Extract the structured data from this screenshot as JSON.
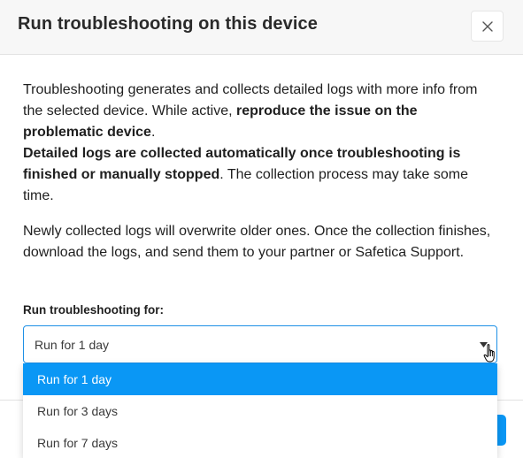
{
  "dialog": {
    "title": "Run troubleshooting on this device",
    "close_icon": "close-icon"
  },
  "body": {
    "paragraph1": {
      "t1": "Troubleshooting generates and collects detailed logs with more info from the selected device. While active, ",
      "b1": "reproduce the issue on the problematic device",
      "t2": ".",
      "b2": "Detailed logs are collected automatically once troubleshooting is finished or manually stopped",
      "t3": ". The collection process may take some time."
    },
    "paragraph2": "Newly collected logs will overwrite older ones. Once the collection finishes, download the logs, and send them to your partner or Safetica Support."
  },
  "duration": {
    "label": "Run troubleshooting for:",
    "selected": "Run for 1 day",
    "arrow_icon": "caret-down-icon",
    "options": [
      {
        "label": "Run for 1 day",
        "selected": true
      },
      {
        "label": "Run for 3 days",
        "selected": false
      },
      {
        "label": "Run for 7 days",
        "selected": false
      }
    ]
  },
  "colors": {
    "accent": "#0a97f5",
    "focus_border": "#1e90e6",
    "header_bg": "#f7f7f7"
  }
}
